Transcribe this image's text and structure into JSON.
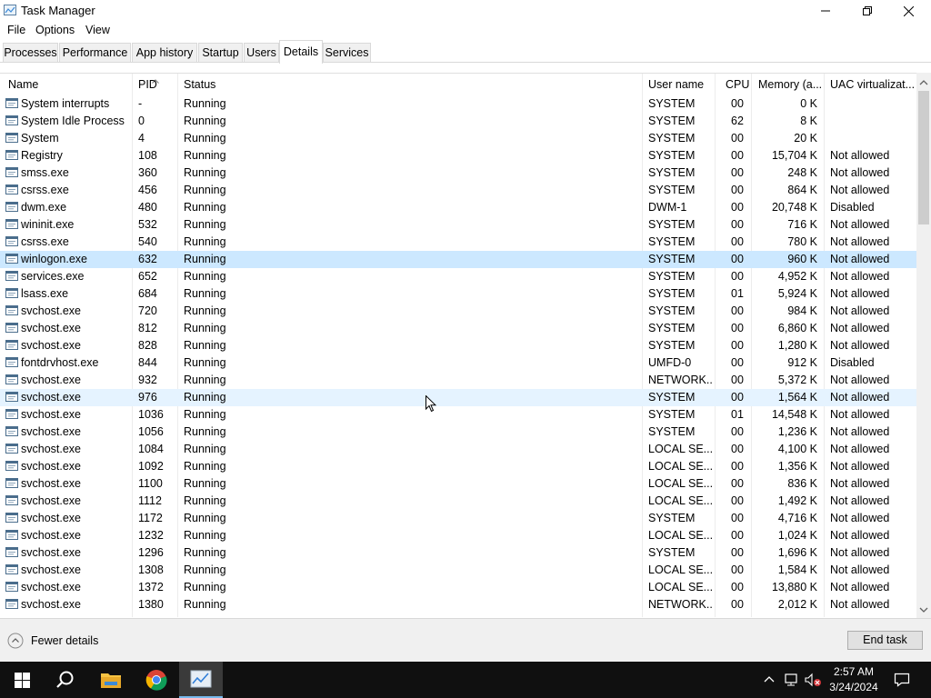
{
  "window": {
    "title": "Task Manager"
  },
  "menu": [
    "File",
    "Options",
    "View"
  ],
  "tabs": [
    "Processes",
    "Performance",
    "App history",
    "Startup",
    "Users",
    "Details",
    "Services"
  ],
  "active_tab": "Details",
  "columns": [
    "Name",
    "PID",
    "Status",
    "User name",
    "CPU",
    "Memory (a...",
    "UAC virtualizat..."
  ],
  "rows": [
    {
      "name": "System interrupts",
      "pid": "-",
      "status": "Running",
      "user": "SYSTEM",
      "cpu": "00",
      "mem": "0 K",
      "uac": ""
    },
    {
      "name": "System Idle Process",
      "pid": "0",
      "status": "Running",
      "user": "SYSTEM",
      "cpu": "62",
      "mem": "8 K",
      "uac": ""
    },
    {
      "name": "System",
      "pid": "4",
      "status": "Running",
      "user": "SYSTEM",
      "cpu": "00",
      "mem": "20 K",
      "uac": ""
    },
    {
      "name": "Registry",
      "pid": "108",
      "status": "Running",
      "user": "SYSTEM",
      "cpu": "00",
      "mem": "15,704 K",
      "uac": "Not allowed"
    },
    {
      "name": "smss.exe",
      "pid": "360",
      "status": "Running",
      "user": "SYSTEM",
      "cpu": "00",
      "mem": "248 K",
      "uac": "Not allowed"
    },
    {
      "name": "csrss.exe",
      "pid": "456",
      "status": "Running",
      "user": "SYSTEM",
      "cpu": "00",
      "mem": "864 K",
      "uac": "Not allowed"
    },
    {
      "name": "dwm.exe",
      "pid": "480",
      "status": "Running",
      "user": "DWM-1",
      "cpu": "00",
      "mem": "20,748 K",
      "uac": "Disabled"
    },
    {
      "name": "wininit.exe",
      "pid": "532",
      "status": "Running",
      "user": "SYSTEM",
      "cpu": "00",
      "mem": "716 K",
      "uac": "Not allowed"
    },
    {
      "name": "csrss.exe",
      "pid": "540",
      "status": "Running",
      "user": "SYSTEM",
      "cpu": "00",
      "mem": "780 K",
      "uac": "Not allowed"
    },
    {
      "name": "winlogon.exe",
      "pid": "632",
      "status": "Running",
      "user": "SYSTEM",
      "cpu": "00",
      "mem": "960 K",
      "uac": "Not allowed",
      "state": "selected"
    },
    {
      "name": "services.exe",
      "pid": "652",
      "status": "Running",
      "user": "SYSTEM",
      "cpu": "00",
      "mem": "4,952 K",
      "uac": "Not allowed"
    },
    {
      "name": "lsass.exe",
      "pid": "684",
      "status": "Running",
      "user": "SYSTEM",
      "cpu": "01",
      "mem": "5,924 K",
      "uac": "Not allowed"
    },
    {
      "name": "svchost.exe",
      "pid": "720",
      "status": "Running",
      "user": "SYSTEM",
      "cpu": "00",
      "mem": "984 K",
      "uac": "Not allowed"
    },
    {
      "name": "svchost.exe",
      "pid": "812",
      "status": "Running",
      "user": "SYSTEM",
      "cpu": "00",
      "mem": "6,860 K",
      "uac": "Not allowed"
    },
    {
      "name": "svchost.exe",
      "pid": "828",
      "status": "Running",
      "user": "SYSTEM",
      "cpu": "00",
      "mem": "1,280 K",
      "uac": "Not allowed"
    },
    {
      "name": "fontdrvhost.exe",
      "pid": "844",
      "status": "Running",
      "user": "UMFD-0",
      "cpu": "00",
      "mem": "912 K",
      "uac": "Disabled"
    },
    {
      "name": "svchost.exe",
      "pid": "932",
      "status": "Running",
      "user": "NETWORK...",
      "cpu": "00",
      "mem": "5,372 K",
      "uac": "Not allowed"
    },
    {
      "name": "svchost.exe",
      "pid": "976",
      "status": "Running",
      "user": "SYSTEM",
      "cpu": "00",
      "mem": "1,564 K",
      "uac": "Not allowed",
      "state": "hover"
    },
    {
      "name": "svchost.exe",
      "pid": "1036",
      "status": "Running",
      "user": "SYSTEM",
      "cpu": "01",
      "mem": "14,548 K",
      "uac": "Not allowed"
    },
    {
      "name": "svchost.exe",
      "pid": "1056",
      "status": "Running",
      "user": "SYSTEM",
      "cpu": "00",
      "mem": "1,236 K",
      "uac": "Not allowed"
    },
    {
      "name": "svchost.exe",
      "pid": "1084",
      "status": "Running",
      "user": "LOCAL SE...",
      "cpu": "00",
      "mem": "4,100 K",
      "uac": "Not allowed"
    },
    {
      "name": "svchost.exe",
      "pid": "1092",
      "status": "Running",
      "user": "LOCAL SE...",
      "cpu": "00",
      "mem": "1,356 K",
      "uac": "Not allowed"
    },
    {
      "name": "svchost.exe",
      "pid": "1100",
      "status": "Running",
      "user": "LOCAL SE...",
      "cpu": "00",
      "mem": "836 K",
      "uac": "Not allowed"
    },
    {
      "name": "svchost.exe",
      "pid": "1112",
      "status": "Running",
      "user": "LOCAL SE...",
      "cpu": "00",
      "mem": "1,492 K",
      "uac": "Not allowed"
    },
    {
      "name": "svchost.exe",
      "pid": "1172",
      "status": "Running",
      "user": "SYSTEM",
      "cpu": "00",
      "mem": "4,716 K",
      "uac": "Not allowed"
    },
    {
      "name": "svchost.exe",
      "pid": "1232",
      "status": "Running",
      "user": "LOCAL SE...",
      "cpu": "00",
      "mem": "1,024 K",
      "uac": "Not allowed"
    },
    {
      "name": "svchost.exe",
      "pid": "1296",
      "status": "Running",
      "user": "SYSTEM",
      "cpu": "00",
      "mem": "1,696 K",
      "uac": "Not allowed"
    },
    {
      "name": "svchost.exe",
      "pid": "1308",
      "status": "Running",
      "user": "LOCAL SE...",
      "cpu": "00",
      "mem": "1,584 K",
      "uac": "Not allowed"
    },
    {
      "name": "svchost.exe",
      "pid": "1372",
      "status": "Running",
      "user": "LOCAL SE...",
      "cpu": "00",
      "mem": "13,880 K",
      "uac": "Not allowed"
    },
    {
      "name": "svchost.exe",
      "pid": "1380",
      "status": "Running",
      "user": "NETWORK...",
      "cpu": "00",
      "mem": "2,012 K",
      "uac": "Not allowed"
    }
  ],
  "footer": {
    "fewer_details": "Fewer details",
    "end_task": "End task"
  },
  "taskbar": {
    "apps": [
      "start-icon",
      "search-icon",
      "file-explorer-icon",
      "chrome-icon",
      "task-manager-icon"
    ],
    "time": "2:57 AM",
    "date": "3/24/2024"
  },
  "colors": {
    "selected_row": "#cce8ff",
    "hover_row": "#e5f3ff",
    "taskbar": "#101010",
    "accent": "#76b9ed"
  }
}
